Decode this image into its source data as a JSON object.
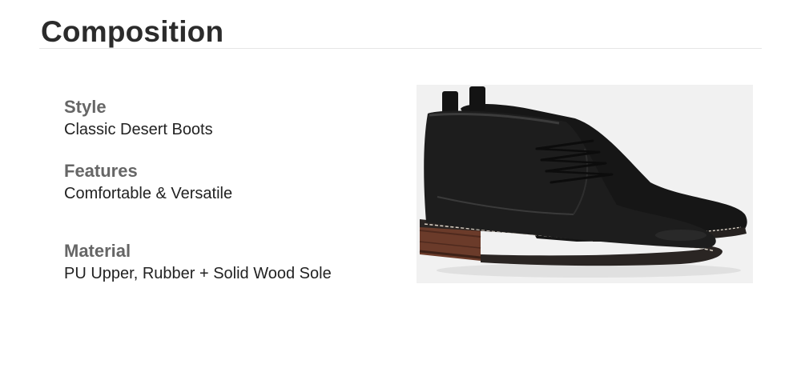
{
  "heading": "Composition",
  "attributes": [
    {
      "label": "Style",
      "value": "Classic Desert Boots"
    },
    {
      "label": "Features",
      "value": "Comfortable & Versatile"
    },
    {
      "label": "Material",
      "value": "PU Upper, Rubber + Solid Wood Sole"
    }
  ],
  "image": {
    "subject": "pair of black leather lace-up chukka boots with stitched stacked wood heel",
    "colors": {
      "background": "#f1f1f1",
      "leather": "#1d1d1d",
      "sole": "#2a2523",
      "heel_wood": "#6b3b2a",
      "stitching": "#d9d0c4"
    }
  }
}
